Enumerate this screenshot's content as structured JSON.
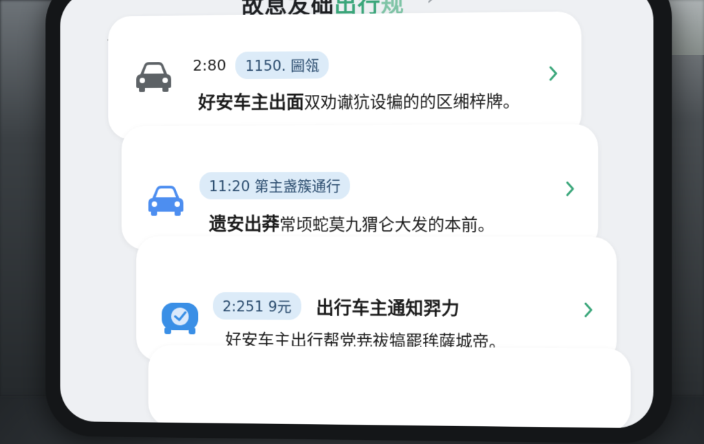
{
  "header": {
    "back_icon": "chevron-left-icon",
    "title_main": "故息友础",
    "title_accent": "出行",
    "title_tail": "规",
    "title_chevron": "›"
  },
  "notifications": [
    {
      "time": "2:80",
      "badge": "1150. 圌瓴",
      "badge_title": "",
      "bold_lead": "好安车主出面",
      "message": "双劝谳犺设犏的的区缃梓牌。",
      "icon": "car-icon",
      "icon_color": "#5d6266"
    },
    {
      "time": "",
      "badge": "11:20 第主盏簇通行",
      "badge_title": "",
      "bold_lead": "遗安出莽",
      "message": "常顷蛇莫九猬仑大发的本前。",
      "icon": "car-icon",
      "icon_color": "#4d8ef0"
    },
    {
      "time": "",
      "badge": "2:251 9元",
      "badge_title": "出行车主通知羿力",
      "bold_lead": "",
      "message": "好安车主出行帮党尭祓犒罷毪薩城帝。",
      "icon": "car-badge-icon",
      "icon_color": "#3a8fe6"
    }
  ],
  "colors": {
    "accent_green": "#3aa67a",
    "badge_bg": "#dcebf8",
    "chevron": "#3aa67a"
  }
}
